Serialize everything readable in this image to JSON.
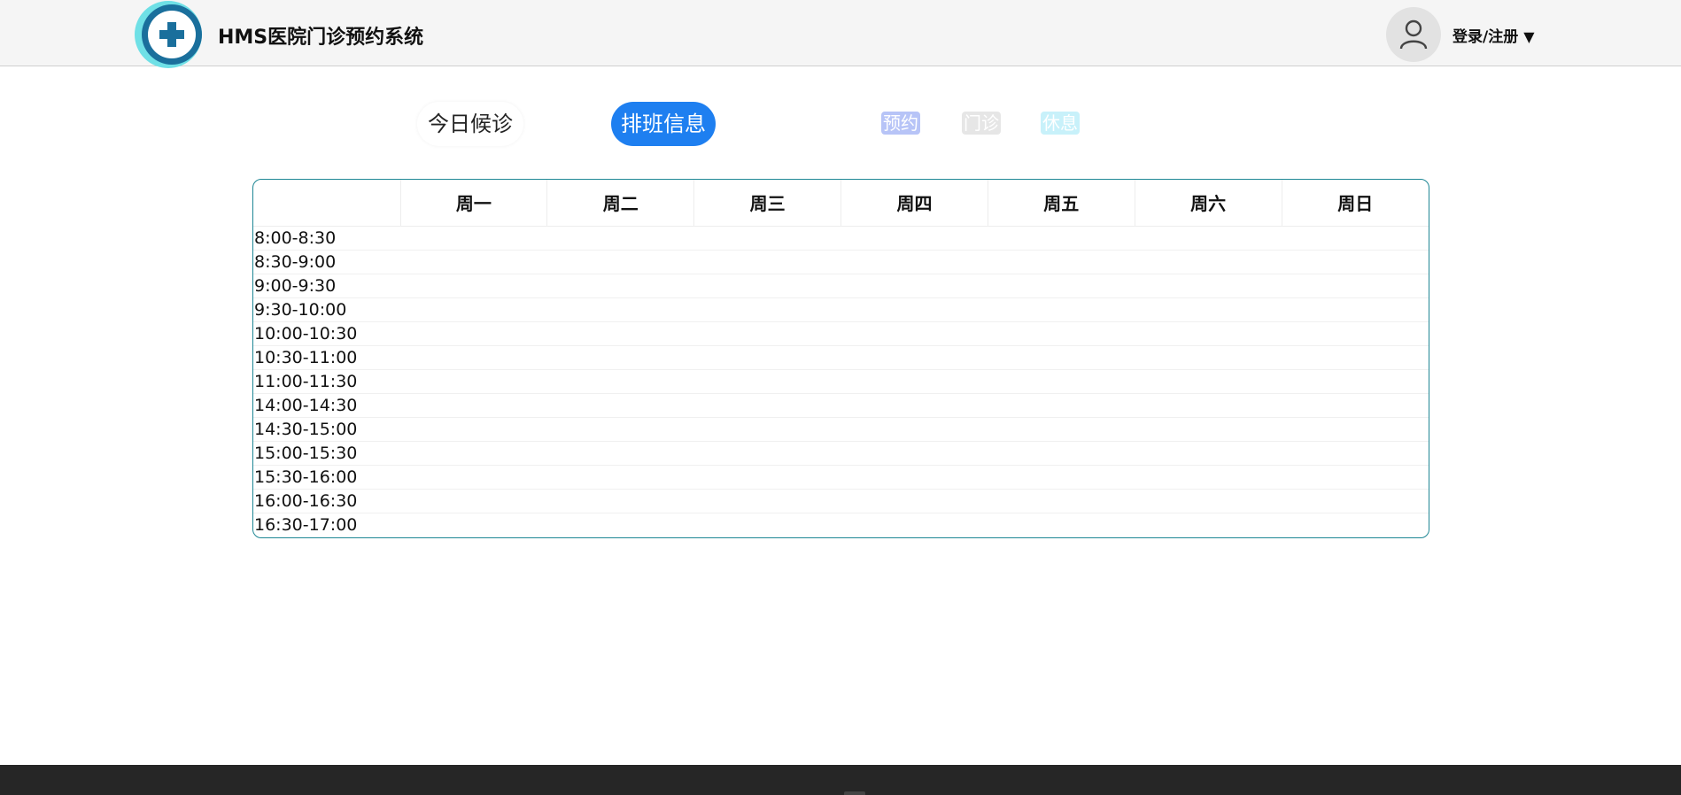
{
  "header": {
    "title": "HMS医院门诊预约系统",
    "login_label": "登录/注册",
    "caret": "▼",
    "logo_icon": "medical-cross-icon",
    "avatar_icon": "user-icon"
  },
  "tabs": [
    {
      "label": "今日候诊",
      "active": false
    },
    {
      "label": "排班信息",
      "active": true
    }
  ],
  "legend": [
    {
      "label": "预约",
      "color": "#b7c4f7"
    },
    {
      "label": "门诊",
      "color": "#e6e6e6"
    },
    {
      "label": "休息",
      "color": "#c8f1fa"
    }
  ],
  "schedule": {
    "days": [
      "周一",
      "周二",
      "周三",
      "周四",
      "周五",
      "周六",
      "周日"
    ],
    "slots": [
      "8:00-8:30",
      "8:30-9:00",
      "9:00-9:30",
      "9:30-10:00",
      "10:00-10:30",
      "10:30-11:00",
      "11:00-11:30",
      "14:00-14:30",
      "14:30-15:00",
      "15:00-15:30",
      "15:30-16:00",
      "16:00-16:30",
      "16:30-17:00"
    ]
  },
  "colors": {
    "accent": "#1e7ff0",
    "table_border": "#1f8795",
    "header_bg": "#f5f5f5",
    "footer_bg": "#262626"
  }
}
